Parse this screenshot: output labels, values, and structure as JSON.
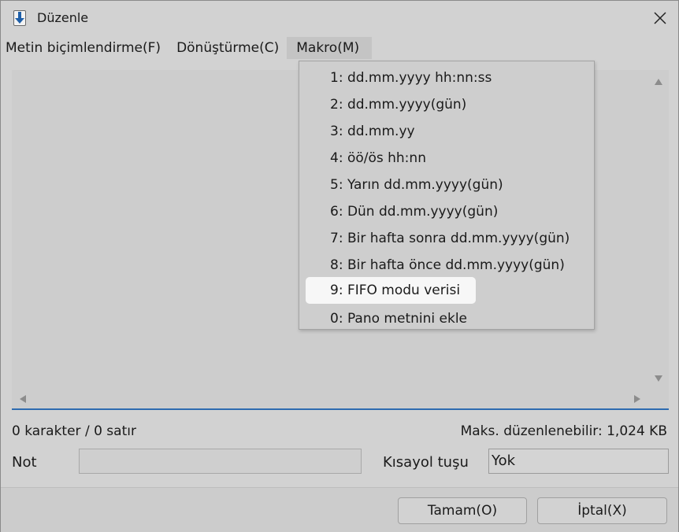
{
  "window": {
    "title": "Düzenle"
  },
  "menu": {
    "items": [
      {
        "label": "Metin biçimlendirme(F)"
      },
      {
        "label": "Dönüştürme(C)"
      },
      {
        "label": "Makro(M)"
      }
    ]
  },
  "macro_menu": {
    "items": [
      {
        "label": "1: dd.mm.yyyy hh:nn:ss"
      },
      {
        "label": "2: dd.mm.yyyy(gün)"
      },
      {
        "label": "3: dd.mm.yy"
      },
      {
        "label": "4: öö/ös hh:nn"
      },
      {
        "label": "5: Yarın dd.mm.yyyy(gün)"
      },
      {
        "label": "6: Dün dd.mm.yyyy(gün)"
      },
      {
        "label": "7: Bir hafta sonra dd.mm.yyyy(gün)"
      },
      {
        "label": "8: Bir hafta önce dd.mm.yyyy(gün)"
      },
      {
        "label": "9: FIFO modu verisi"
      },
      {
        "label": "0: Pano metnini ekle"
      }
    ],
    "highlighted_index": 8
  },
  "status": {
    "count": "0 karakter / 0 satır",
    "max_size": "Maks. düzenlenebilir: 1,024 KB"
  },
  "fields": {
    "note_label": "Not",
    "note_value": "",
    "hotkey_label": "Kısayol tuşu",
    "hotkey_value": "Yok"
  },
  "buttons": {
    "ok": "Tamam(O)",
    "cancel": "İptal(X)"
  },
  "colors": {
    "accent": "#2e6bb0",
    "icon_blue": "#1f5fa8"
  },
  "icons": {
    "app": "download-arrow-icon",
    "close": "close-icon"
  }
}
